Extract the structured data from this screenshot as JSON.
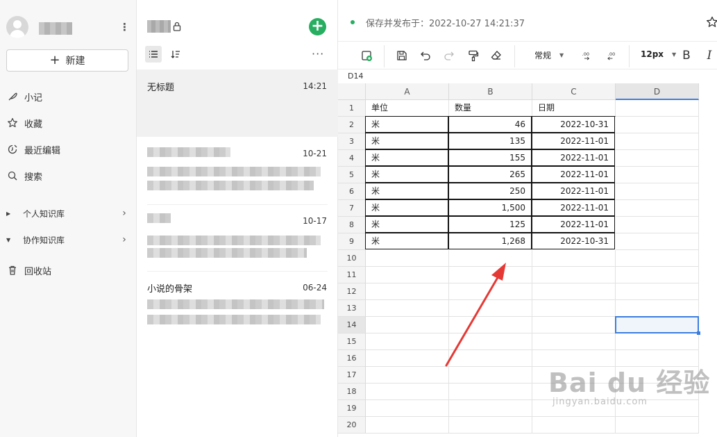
{
  "sidebar": {
    "new_label": "新建",
    "nav": [
      {
        "label": "小记",
        "icon": "feather-icon"
      },
      {
        "label": "收藏",
        "icon": "star-icon"
      },
      {
        "label": "最近编辑",
        "icon": "recent-edit-icon"
      },
      {
        "label": "搜索",
        "icon": "search-icon"
      }
    ],
    "knowledge": [
      {
        "label": "个人知识库"
      },
      {
        "label": "协作知识库"
      }
    ],
    "trash_label": "回收站"
  },
  "notelist": {
    "notes": [
      {
        "title": "无标题",
        "time": "14:21"
      },
      {
        "title": "",
        "time": "10-21"
      },
      {
        "title": "",
        "time": "10-17"
      },
      {
        "title": "小说的骨架",
        "time": "06-24"
      }
    ]
  },
  "editor": {
    "save_status": "保存并发布于：2022-10-27 14:21:37",
    "cell_ref": "D14",
    "toolbar": {
      "format_select": "常规",
      "font_size": "12px",
      "bold_label": "B",
      "italic_label": "I"
    },
    "columns": [
      "A",
      "B",
      "C",
      "D"
    ],
    "rows": [
      "1",
      "2",
      "3",
      "4",
      "5",
      "6",
      "7",
      "8",
      "9",
      "10",
      "11",
      "12",
      "13",
      "14",
      "15",
      "16",
      "17",
      "18",
      "19",
      "20"
    ],
    "table": {
      "headers": [
        "单位",
        "数量",
        "日期"
      ],
      "data": [
        [
          "米",
          "46",
          "2022-10-31"
        ],
        [
          "米",
          "135",
          "2022-11-01"
        ],
        [
          "米",
          "155",
          "2022-11-01"
        ],
        [
          "米",
          "265",
          "2022-11-01"
        ],
        [
          "米",
          "250",
          "2022-11-01"
        ],
        [
          "米",
          "1,500",
          "2022-11-01"
        ],
        [
          "米",
          "125",
          "2022-11-01"
        ],
        [
          "米",
          "1,268",
          "2022-10-31"
        ]
      ]
    },
    "selected_cell": "D14"
  },
  "watermark": {
    "brand": "Bai du 经验",
    "url": "jingyan.baidu.com"
  },
  "colors": {
    "accent_green": "#27ae60",
    "selection_blue": "#3b7ddd",
    "annotation_red": "#e53935"
  }
}
